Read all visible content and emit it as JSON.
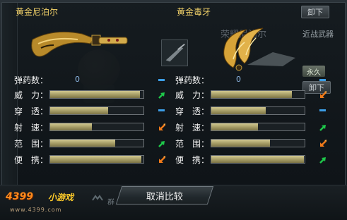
{
  "left": {
    "name": "黄金尼泊尔",
    "ammo_label": "弹药数：",
    "ammo_value": "0",
    "stats": [
      {
        "label": "威　力：",
        "value": 0.96,
        "indicator": "up-green"
      },
      {
        "label": "穿　透：",
        "value": 0.62,
        "indicator": "equal-blue"
      },
      {
        "label": "射　速：",
        "value": 0.45,
        "indicator": "down-orange"
      },
      {
        "label": "范　围：",
        "value": 0.7,
        "indicator": "up-green"
      },
      {
        "label": "便　携：",
        "value": 0.98,
        "indicator": "down-orange"
      }
    ]
  },
  "right": {
    "name": "黄金毒牙",
    "ammo_label": "弹药数：",
    "ammo_value": "0",
    "stats": [
      {
        "label": "威　力：",
        "value": 0.86,
        "indicator": "down-orange"
      },
      {
        "label": "穿　透：",
        "value": 0.58,
        "indicator": "equal-blue"
      },
      {
        "label": "射　速：",
        "value": 0.5,
        "indicator": "up-green"
      },
      {
        "label": "范　围：",
        "value": 0.63,
        "indicator": "down-orange"
      },
      {
        "label": "便　携：",
        "value": 0.99,
        "indicator": "up-green"
      }
    ]
  },
  "background": {
    "weapon_name": "荣耀尼泊尔",
    "melee_label": "近战武器",
    "unload_top": "卸下",
    "unload_mid": "卸下",
    "permanent_badge": "永久"
  },
  "footer": {
    "logo_main": "4399",
    "logo_sub": "小游戏",
    "logo_url": "www.4399.com",
    "group_text": "群",
    "cancel_label": "取消比较"
  },
  "colors": {
    "name_gold": "#f4d36a",
    "bar_fill": "#b8ae74",
    "up_green": "#1ec84a",
    "down_orange": "#f07a1a",
    "equal_blue": "#3c9ee6"
  }
}
